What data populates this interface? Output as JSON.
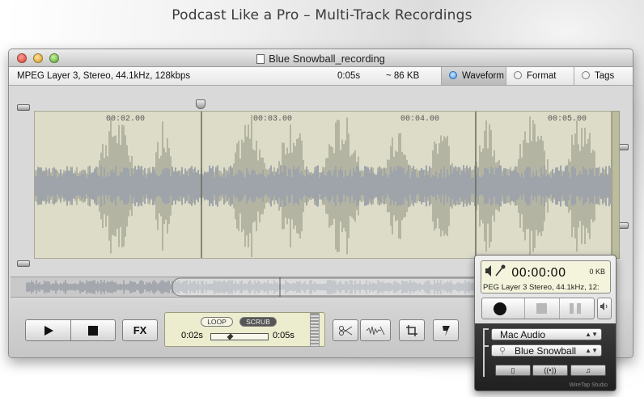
{
  "banner": {
    "title": "Podcast Like a Pro – Multi-Track Recordings"
  },
  "window": {
    "title": "Blue Snowball_recording",
    "info": {
      "format": "MPEG Layer 3, Stereo, 44.1kHz, 128kbps",
      "duration": "0:05s",
      "size": "~ 86 KB"
    },
    "tabs": [
      {
        "label": "Waveform",
        "selected": true
      },
      {
        "label": "Format",
        "selected": false
      },
      {
        "label": "Tags",
        "selected": false
      }
    ]
  },
  "timeline": {
    "ticks": [
      "00:02.00",
      "00:03.00",
      "00:04.00",
      "00:05.00"
    ]
  },
  "controls": {
    "fx_label": "FX",
    "loop_label": "LOOP",
    "scrub_label": "SCRUB",
    "scrub_start": "0:02s",
    "scrub_end": "0:05s",
    "scrub_position": 0.33
  },
  "widget": {
    "time": "00:00:00",
    "size": "0 KB",
    "format": "PEG Layer 3 Stereo, 44.1kHz, 12:",
    "source": "Mac Audio",
    "device": "Blue Snowball",
    "footer": "WireTap Studio"
  },
  "colors": {
    "accent": "#3d8ee8",
    "wave_bg": "#dcdcc8",
    "wave_fg": "#9c9c8c"
  }
}
